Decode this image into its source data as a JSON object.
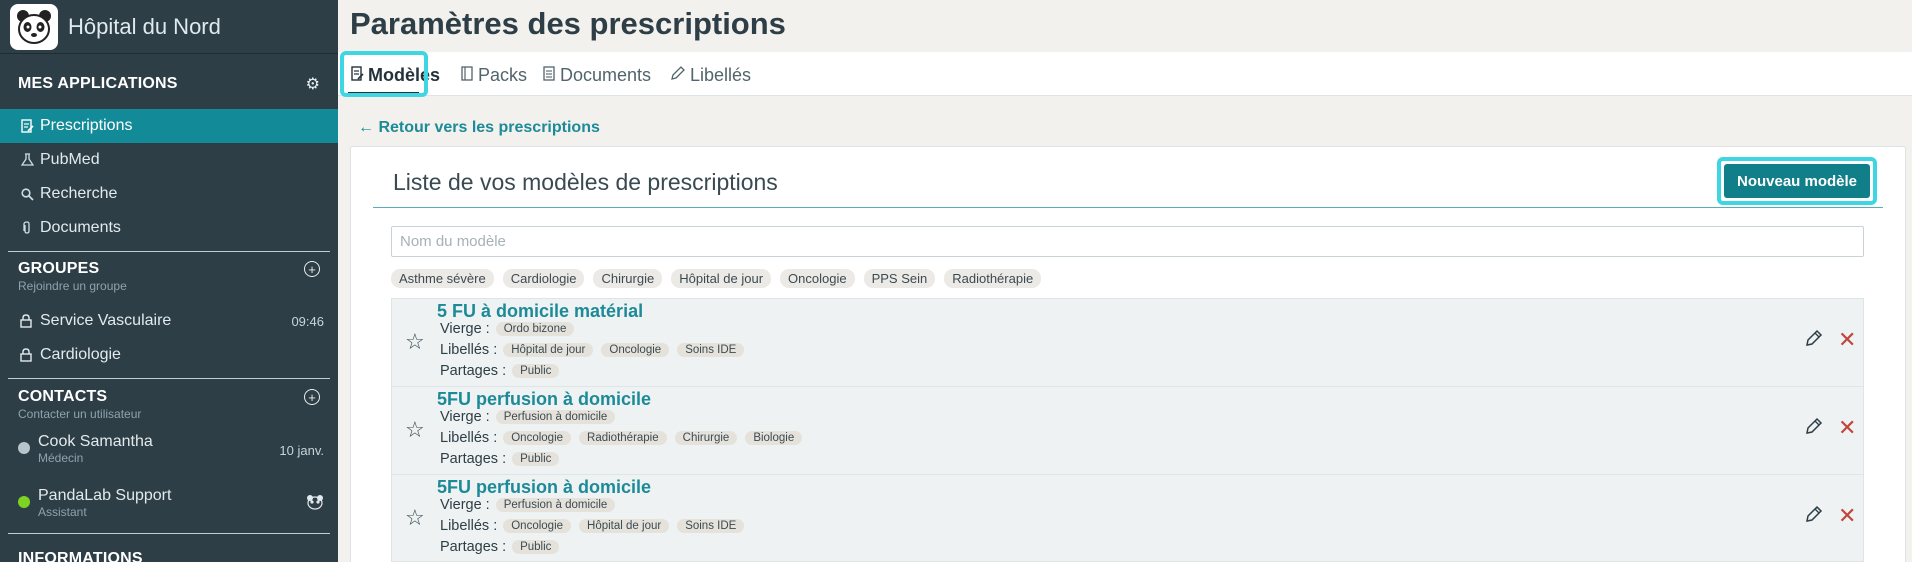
{
  "brand": {
    "name": "Hôpital du Nord",
    "logo_icon": "panda-icon"
  },
  "sidebar": {
    "apps_title": "MES APPLICATIONS",
    "apps": [
      {
        "label": "Prescriptions",
        "icon": "prescription-icon",
        "active": true
      },
      {
        "label": "PubMed",
        "icon": "pubmed-icon",
        "active": false
      },
      {
        "label": "Recherche",
        "icon": "search-icon",
        "active": false
      },
      {
        "label": "Documents",
        "icon": "paperclip-icon",
        "active": false
      }
    ],
    "groups_title": "GROUPES",
    "groups_sub": "Rejoindre un groupe",
    "groups": [
      {
        "label": "Service Vasculaire",
        "time": "09:46",
        "icon": "lock-icon"
      },
      {
        "label": "Cardiologie",
        "time": "",
        "icon": "lock-icon"
      }
    ],
    "contacts_title": "CONTACTS",
    "contacts_sub": "Contacter un utilisateur",
    "contacts": [
      {
        "name": "Cook Samantha",
        "role": "Médecin",
        "meta": "10 janv.",
        "status_color": "#b7c4ca"
      },
      {
        "name": "PandaLab Support",
        "role": "Assistant",
        "meta": "",
        "status_color": "#7dd321"
      }
    ],
    "info_title": "INFORMATIONS"
  },
  "page": {
    "title": "Paramètres des prescriptions",
    "tabs": [
      {
        "label": "Modèles",
        "icon": "template-icon",
        "active": true
      },
      {
        "label": "Packs",
        "icon": "pack-icon",
        "active": false
      },
      {
        "label": "Documents",
        "icon": "document-icon",
        "active": false
      },
      {
        "label": "Libellés",
        "icon": "pencil-icon",
        "active": false
      }
    ],
    "back_link": "← Retour vers les prescriptions"
  },
  "list": {
    "title": "Liste de vos modèles de prescriptions",
    "new_button": "Nouveau modèle",
    "search_placeholder": "Nom du modèle",
    "filters": [
      "Asthme sévère",
      "Cardiologie",
      "Chirurgie",
      "Hôpital de jour",
      "Oncologie",
      "PPS Sein",
      "Radiothérapie"
    ],
    "vierge_label": "Vierge :",
    "libelles_label": "Libellés :",
    "partages_label": "Partages :",
    "items": [
      {
        "name": "5 FU à domicile matérial",
        "vierge": "Ordo bizone",
        "libelles": [
          "Hôpital de jour",
          "Oncologie",
          "Soins IDE"
        ],
        "partages": "Public"
      },
      {
        "name": "5FU perfusion à domicile",
        "vierge": "Perfusion à domicile",
        "libelles": [
          "Oncologie",
          "Radiothérapie",
          "Chirurgie",
          "Biologie"
        ],
        "partages": "Public"
      },
      {
        "name": "5FU perfusion à domicile",
        "vierge": "Perfusion à domicile",
        "libelles": [
          "Oncologie",
          "Hôpital de jour",
          "Soins IDE"
        ],
        "partages": "Public"
      }
    ]
  }
}
